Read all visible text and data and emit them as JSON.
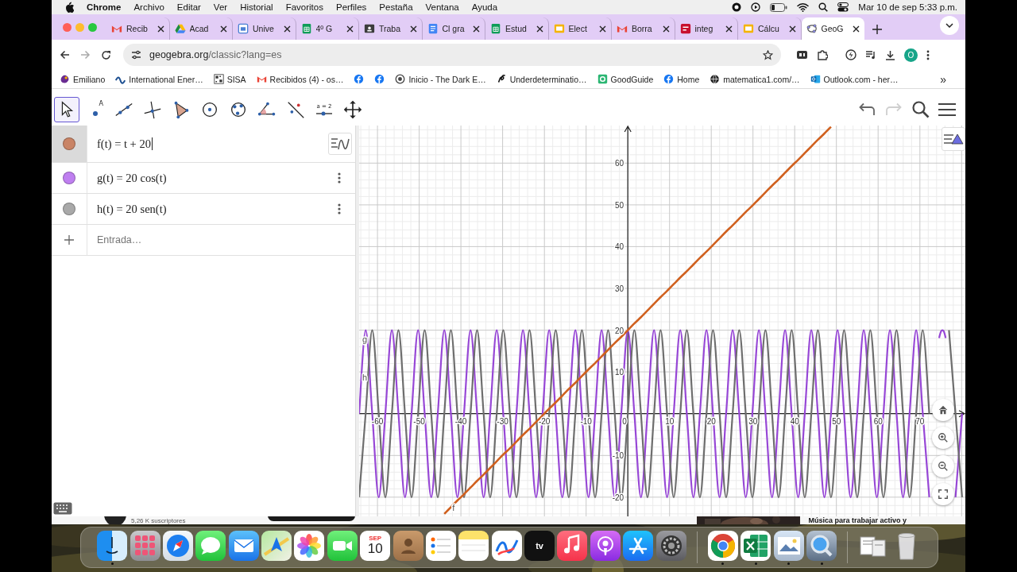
{
  "menu_bar": {
    "app_name": "Chrome",
    "menus": [
      "Archivo",
      "Editar",
      "Ver",
      "Historial",
      "Favoritos",
      "Perfiles",
      "Pestaña",
      "Ventana",
      "Ayuda"
    ],
    "clock": "Mar 10 de sep  5:33 p.m."
  },
  "tabs": [
    {
      "title": "Recib",
      "selected": false
    },
    {
      "title": "Acad",
      "selected": false
    },
    {
      "title": "Unive",
      "selected": false
    },
    {
      "title": "4º G",
      "selected": false
    },
    {
      "title": "Traba",
      "selected": false
    },
    {
      "title": "Cl gra",
      "selected": false
    },
    {
      "title": "Estud",
      "selected": false
    },
    {
      "title": "Elect",
      "selected": false
    },
    {
      "title": "Borra",
      "selected": false
    },
    {
      "title": "integ",
      "selected": false
    },
    {
      "title": "Cálcu",
      "selected": false
    },
    {
      "title": "GeoG",
      "selected": true
    }
  ],
  "address_bar": {
    "url": "**geogebra.org**/classic?lang=es"
  },
  "profile": {
    "initial": "O"
  },
  "bookmarks": [
    {
      "kind": "link",
      "label": "Emiliano"
    },
    {
      "kind": "link",
      "label": "International Ener…"
    },
    {
      "kind": "link",
      "label": "SISA"
    },
    {
      "kind": "link",
      "label": "Recibidos (4) - os…"
    },
    {
      "kind": "icon"
    },
    {
      "kind": "icon"
    },
    {
      "kind": "link",
      "label": "Inicio - The Dark E…"
    },
    {
      "kind": "link",
      "label": "Underdeterminatio…"
    },
    {
      "kind": "link",
      "label": "GoodGuide"
    },
    {
      "kind": "link",
      "label": "Home"
    },
    {
      "kind": "link",
      "label": "matematica1.com/…"
    },
    {
      "kind": "link",
      "label": "Outlook.com - her…"
    }
  ],
  "bookmarks_overflow": "»",
  "toolbar": {
    "tools": [
      {
        "selected": true
      },
      {
        "selected": false,
        "label": "A"
      },
      {
        "selected": false
      },
      {
        "selected": false
      },
      {
        "selected": false
      },
      {
        "selected": false
      },
      {
        "selected": false
      },
      {
        "selected": false
      },
      {
        "selected": false
      },
      {
        "selected": false,
        "label": "a = 2"
      },
      {
        "selected": false
      }
    ],
    "undo": {
      "disabled": false
    },
    "redo": {
      "disabled": true
    }
  },
  "algebra": {
    "rows": [
      {
        "expression": "f(t) = t + 20",
        "color": "#c98466",
        "editing": true
      },
      {
        "expression": "g(t) = 20 cos(t)",
        "color": "#bf7ff0",
        "editing": false
      },
      {
        "expression": "h(t) = 20 sen(t)",
        "color": "#a9a9a9",
        "editing": false
      }
    ],
    "input_placeholder": "Entrada…"
  },
  "graphics": {
    "chart_data": {
      "type": "line",
      "grid": true,
      "xlim": [
        -64.4,
        80.9
      ],
      "ylim": [
        -24.6,
        69
      ],
      "xticks": [
        -60,
        -50,
        -40,
        -30,
        -20,
        -10,
        0,
        10,
        20,
        30,
        40,
        50,
        60,
        70
      ],
      "yticks": [
        -20,
        -10,
        10,
        20,
        30,
        40,
        50,
        60
      ],
      "x": [
        -64.4,
        -62.83,
        -61.26,
        -59.69,
        -58.12,
        -56.55,
        -54.98,
        -53.41,
        -51.84,
        -50.27,
        -48.69,
        -47.12,
        -45.55,
        -43.98,
        -42.41,
        -40.84,
        -39.27,
        -37.7,
        -36.13,
        -34.56,
        -32.99,
        -31.42,
        -29.85,
        -28.27,
        -26.7,
        -25.13,
        -23.56,
        -21.99,
        -20.42,
        -18.85,
        -17.28,
        -15.71,
        -14.14,
        -12.57,
        -11.0,
        -9.42,
        -7.85,
        -6.28,
        -4.71,
        -3.14,
        -1.57,
        0,
        1.57,
        3.14,
        4.71,
        6.28,
        7.85,
        9.42,
        11.0,
        12.57,
        14.14,
        15.71,
        17.28,
        18.85,
        20.42,
        21.99,
        23.56,
        25.13,
        26.7,
        28.27,
        29.85,
        31.42,
        32.99,
        34.56,
        36.13,
        37.7,
        39.27,
        40.84,
        42.41,
        43.98,
        45.55,
        47.12,
        48.69,
        50.27,
        51.84,
        53.41,
        54.98,
        56.55,
        58.12,
        59.69,
        61.26,
        62.83,
        64.4,
        65.97,
        67.54,
        69.12,
        70.69,
        72.26,
        73.83,
        75.4,
        76.97,
        78.54,
        80.11
      ],
      "series": [
        {
          "name": "g",
          "color": "#9747d6",
          "values": [
            0,
            20,
            0,
            -20,
            0,
            20,
            0,
            -20,
            0,
            20,
            0,
            -20,
            0,
            20,
            0,
            -20,
            0,
            20,
            0,
            -20,
            0,
            20,
            0,
            -20,
            0,
            20,
            0,
            -20,
            0,
            20,
            0,
            -20,
            0,
            20,
            0,
            -20,
            0,
            20,
            0,
            -20,
            0,
            20,
            0,
            -20,
            0,
            20,
            0,
            -20,
            0,
            20,
            0,
            -20,
            0,
            20,
            0,
            -20,
            0,
            20,
            0,
            -20,
            0,
            20,
            0,
            -20,
            0,
            20,
            0,
            -20,
            0,
            20,
            0,
            -20,
            0,
            20,
            0,
            -20,
            0,
            20,
            0,
            -20,
            0,
            20,
            0,
            -20,
            0,
            20,
            0,
            -20,
            null,
            20,
            null,
            -20,
            0
          ]
        },
        {
          "name": "h",
          "color": "#6e6e6e",
          "values": [
            -20,
            0,
            20,
            0,
            -20,
            0,
            20,
            0,
            -20,
            0,
            20,
            0,
            -20,
            0,
            20,
            0,
            -20,
            0,
            20,
            0,
            -20,
            0,
            20,
            0,
            -20,
            0,
            20,
            0,
            -20,
            0,
            20,
            0,
            -20,
            0,
            20,
            0,
            -20,
            0,
            20,
            0,
            -20,
            0,
            20,
            0,
            -20,
            0,
            20,
            0,
            -20,
            0,
            20,
            0,
            -20,
            0,
            20,
            0,
            -20,
            0,
            20,
            0,
            -20,
            0,
            20,
            0,
            -20,
            0,
            20,
            0,
            -20,
            0,
            20,
            0,
            -20,
            0,
            20,
            0,
            -20,
            0,
            20,
            0,
            -20,
            0,
            20,
            0,
            -20,
            0,
            20,
            0,
            null,
            null,
            20,
            0,
            -20
          ]
        },
        {
          "name": "f",
          "color": "#d0601e",
          "values": [
            null,
            null,
            null,
            null,
            null,
            null,
            null,
            null,
            null,
            null,
            null,
            null,
            null,
            -24.0,
            -22.4,
            -20.8,
            -19.3,
            -17.7,
            -16.1,
            -14.6,
            -13.0,
            -11.4,
            -9.8,
            -8.3,
            -6.7,
            -5.1,
            -3.6,
            -2.0,
            -0.4,
            1.2,
            2.7,
            4.3,
            5.9,
            7.4,
            9.0,
            10.6,
            12.1,
            13.7,
            15.3,
            16.9,
            18.4,
            20,
            21.6,
            23.1,
            24.7,
            26.3,
            27.9,
            29.4,
            31.0,
            32.6,
            34.1,
            35.7,
            37.3,
            38.8,
            40.4,
            42.0,
            43.6,
            45.1,
            46.7,
            48.3,
            49.8,
            51.4,
            53.0,
            54.6,
            56.1,
            57.7,
            59.3,
            60.8,
            62.4,
            64.0,
            65.6,
            67.1,
            68.7,
            null,
            null,
            null,
            null,
            null,
            null,
            null,
            null,
            null,
            null,
            null,
            null,
            null,
            null,
            null,
            null,
            null,
            null,
            null,
            null
          ]
        }
      ]
    }
  },
  "background_page": {
    "subscriber_count": "5,26 K suscriptores",
    "video_title": "Música para trabajar activo y"
  },
  "dock": {
    "apps": [
      {
        "running": true
      },
      {
        "running": false
      },
      {
        "running": false
      },
      {
        "running": false
      },
      {
        "running": false
      },
      {
        "running": false
      },
      {
        "running": false
      },
      {
        "running": false
      },
      {
        "running": false,
        "month": "SEP",
        "day": "10"
      },
      {
        "running": false
      },
      {
        "running": false
      },
      {
        "running": false
      },
      {
        "running": false
      },
      {
        "running": false,
        "label": "tv"
      },
      {
        "running": false
      },
      {
        "running": false
      },
      {
        "running": false
      },
      {
        "running": false
      }
    ],
    "recent_apps": [
      {
        "running": true
      },
      {
        "running": true
      },
      {
        "running": true
      },
      {
        "running": true
      }
    ],
    "documents": [
      {
        "running": false
      },
      {
        "running": false
      }
    ]
  }
}
